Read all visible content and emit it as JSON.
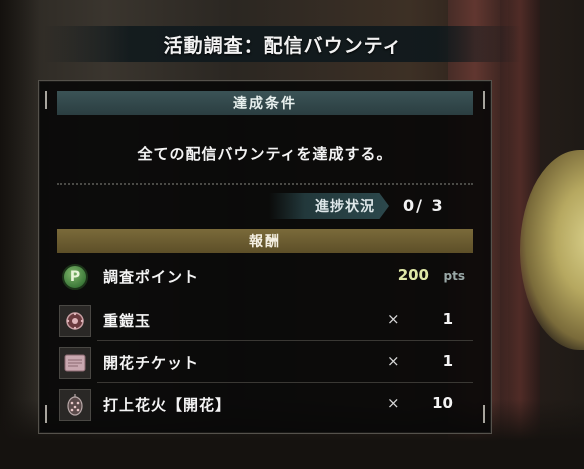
{
  "window": {
    "title": "活動調査：配信バウンティ"
  },
  "condition": {
    "header": "達成条件",
    "text": "全ての配信バウンティを達成する。",
    "progress_label": "進捗状況",
    "progress_value": "0/ 3"
  },
  "reward": {
    "header": "報酬",
    "items": [
      {
        "name": "調査ポイント",
        "value": "200",
        "unit": "pts",
        "icon": "research-point-icon"
      },
      {
        "name": "重鎧玉",
        "times": "×",
        "qty": "1",
        "icon": "armor-sphere-icon"
      },
      {
        "name": "開花チケット",
        "times": "×",
        "qty": "1",
        "icon": "ticket-icon"
      },
      {
        "name": "打上花火【開花】",
        "times": "×",
        "qty": "10",
        "icon": "firework-icon"
      }
    ]
  },
  "colors": {
    "condition_header": "#3b5356",
    "reward_header": "#7a6a3a",
    "points_value": "#dfe8a8"
  }
}
